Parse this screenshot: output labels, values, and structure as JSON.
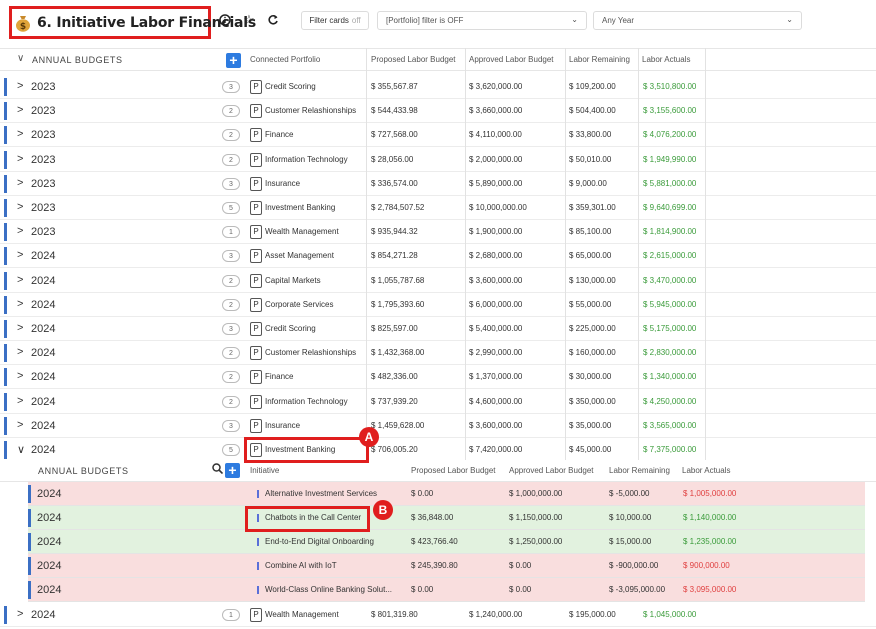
{
  "toolbar": {
    "title": "6. Initiative Labor Financials",
    "filter_cards_label": "Filter cards",
    "filter_cards_state": "off",
    "portfolio_filter": "[Portfolio] filter is OFF",
    "year_filter": "Any Year"
  },
  "header": {
    "section_label": "ANNUAL BUDGETS",
    "columns": [
      "Connected Portfolio",
      "Proposed Labor Budget",
      "Approved Labor Budget",
      "Labor Remaining",
      "Labor Actuals"
    ]
  },
  "rows": [
    {
      "year": "2023",
      "count": "3",
      "portfolio": "Credit Scoring",
      "proposed": "$ 355,567.87",
      "approved": "$ 3,620,000.00",
      "remaining": "$ 109,200.00",
      "actuals": "$ 3,510,800.00"
    },
    {
      "year": "2023",
      "count": "2",
      "portfolio": "Customer Relashionships",
      "proposed": "$ 544,433.98",
      "approved": "$ 3,660,000.00",
      "remaining": "$ 504,400.00",
      "actuals": "$ 3,155,600.00"
    },
    {
      "year": "2023",
      "count": "2",
      "portfolio": "Finance",
      "proposed": "$ 727,568.00",
      "approved": "$ 4,110,000.00",
      "remaining": "$ 33,800.00",
      "actuals": "$ 4,076,200.00"
    },
    {
      "year": "2023",
      "count": "2",
      "portfolio": "Information Technology",
      "proposed": "$ 28,056.00",
      "approved": "$ 2,000,000.00",
      "remaining": "$ 50,010.00",
      "actuals": "$ 1,949,990.00"
    },
    {
      "year": "2023",
      "count": "3",
      "portfolio": "Insurance",
      "proposed": "$ 336,574.00",
      "approved": "$ 5,890,000.00",
      "remaining": "$ 9,000.00",
      "actuals": "$ 5,881,000.00"
    },
    {
      "year": "2023",
      "count": "5",
      "portfolio": "Investment Banking",
      "proposed": "$ 2,784,507.52",
      "approved": "$ 10,000,000.00",
      "remaining": "$ 359,301.00",
      "actuals": "$ 9,640,699.00"
    },
    {
      "year": "2023",
      "count": "1",
      "portfolio": "Wealth Management",
      "proposed": "$ 935,944.32",
      "approved": "$ 1,900,000.00",
      "remaining": "$ 85,100.00",
      "actuals": "$ 1,814,900.00"
    },
    {
      "year": "2024",
      "count": "3",
      "portfolio": "Asset Management",
      "proposed": "$ 854,271.28",
      "approved": "$ 2,680,000.00",
      "remaining": "$ 65,000.00",
      "actuals": "$ 2,615,000.00"
    },
    {
      "year": "2024",
      "count": "2",
      "portfolio": "Capital Markets",
      "proposed": "$ 1,055,787.68",
      "approved": "$ 3,600,000.00",
      "remaining": "$ 130,000.00",
      "actuals": "$ 3,470,000.00"
    },
    {
      "year": "2024",
      "count": "2",
      "portfolio": "Corporate Services",
      "proposed": "$ 1,795,393.60",
      "approved": "$ 6,000,000.00",
      "remaining": "$ 55,000.00",
      "actuals": "$ 5,945,000.00"
    },
    {
      "year": "2024",
      "count": "3",
      "portfolio": "Credit Scoring",
      "proposed": "$ 825,597.00",
      "approved": "$ 5,400,000.00",
      "remaining": "$ 225,000.00",
      "actuals": "$ 5,175,000.00"
    },
    {
      "year": "2024",
      "count": "2",
      "portfolio": "Customer Relashionships",
      "proposed": "$ 1,432,368.00",
      "approved": "$ 2,990,000.00",
      "remaining": "$ 160,000.00",
      "actuals": "$ 2,830,000.00"
    },
    {
      "year": "2024",
      "count": "2",
      "portfolio": "Finance",
      "proposed": "$ 482,336.00",
      "approved": "$ 1,370,000.00",
      "remaining": "$ 30,000.00",
      "actuals": "$ 1,340,000.00"
    },
    {
      "year": "2024",
      "count": "2",
      "portfolio": "Information Technology",
      "proposed": "$ 737,939.20",
      "approved": "$ 4,600,000.00",
      "remaining": "$ 350,000.00",
      "actuals": "$ 4,250,000.00"
    },
    {
      "year": "2024",
      "count": "3",
      "portfolio": "Insurance",
      "proposed": "$ 1,459,628.00",
      "approved": "$ 3,600,000.00",
      "remaining": "$ 35,000.00",
      "actuals": "$ 3,565,000.00"
    },
    {
      "year": "2024",
      "count": "5",
      "portfolio": "Investment Banking",
      "proposed": "$ 706,005.20",
      "approved": "$ 7,420,000.00",
      "remaining": "$ 45,000.00",
      "actuals": "$ 7,375,000.00"
    }
  ],
  "sub": {
    "section_label": "ANNUAL BUDGETS",
    "columns": [
      "Initiative",
      "Proposed Labor Budget",
      "Approved Labor Budget",
      "Labor Remaining",
      "Labor Actuals"
    ],
    "rows": [
      {
        "year": "2024",
        "initiative": "Alternative Investment Services",
        "proposed": "$ 0.00",
        "approved": "$ 1,000,000.00",
        "remaining": "$ -5,000.00",
        "actuals": "$ 1,005,000.00"
      },
      {
        "year": "2024",
        "initiative": "Chatbots in the Call Center",
        "proposed": "$ 36,848.00",
        "approved": "$ 1,150,000.00",
        "remaining": "$ 10,000.00",
        "actuals": "$ 1,140,000.00"
      },
      {
        "year": "2024",
        "initiative": "End-to-End Digital Onboarding",
        "proposed": "$ 423,766.40",
        "approved": "$ 1,250,000.00",
        "remaining": "$ 15,000.00",
        "actuals": "$ 1,235,000.00"
      },
      {
        "year": "2024",
        "initiative": "Combine AI with IoT",
        "proposed": "$ 245,390.80",
        "approved": "$ 0.00",
        "remaining": "$ -900,000.00",
        "actuals": "$ 900,000.00"
      },
      {
        "year": "2024",
        "initiative": "World-Class Online Banking Solut...",
        "proposed": "$ 0.00",
        "approved": "$ 0.00",
        "remaining": "$ -3,095,000.00",
        "actuals": "$ 3,095,000.00"
      }
    ]
  },
  "last_row": {
    "year": "2024",
    "count": "1",
    "portfolio": "Wealth Management",
    "proposed": "$ 801,319.80",
    "approved": "$ 1,240,000.00",
    "remaining": "$ 195,000.00",
    "actuals": "$ 1,045,000.00"
  },
  "annotations": {
    "a": "A",
    "b": "B"
  },
  "colors": {
    "accent": "#2d7be0",
    "annotation": "#e01e1e",
    "positive": "#3a9b3a",
    "negative": "#e04040",
    "row_red": "#f9dede",
    "row_green": "#e2f2df"
  }
}
